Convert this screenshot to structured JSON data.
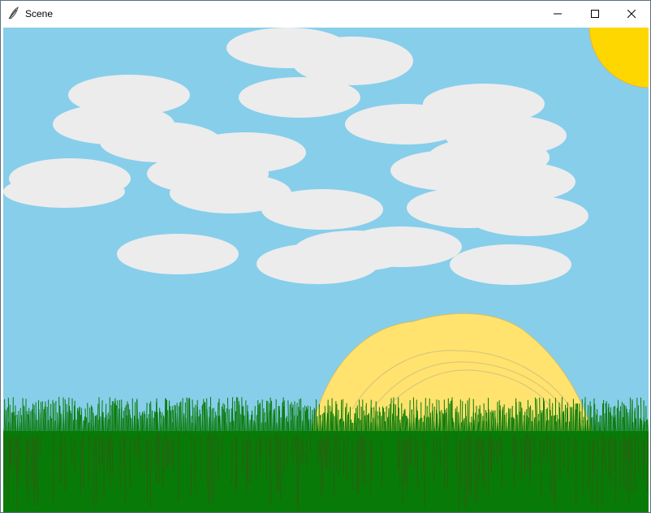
{
  "window": {
    "title": "Scene",
    "app_icon": "feather-icon",
    "buttons": [
      {
        "id": "minimize",
        "icon": "minimize-icon"
      },
      {
        "id": "maximize",
        "icon": "maximize-icon"
      },
      {
        "id": "close",
        "icon": "close-icon"
      }
    ]
  },
  "scene": {
    "elements": [
      "sky",
      "clouds",
      "sun",
      "hay-mound",
      "grass",
      "ground"
    ],
    "colors": {
      "sky": "#87ceeb",
      "cloud": "#ececec",
      "sun": "#ffd700",
      "hay_mound": "#ffe36e",
      "grass": "#087a08",
      "soil_streaks": "#5a3a1d"
    }
  }
}
